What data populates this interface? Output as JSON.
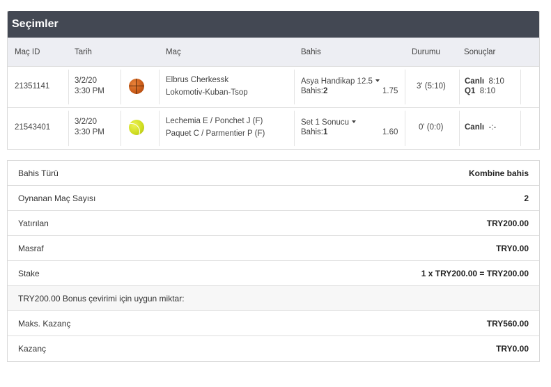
{
  "selections": {
    "title": "Seçimler",
    "headers": {
      "match_id": "Maç ID",
      "date": "Tarih",
      "match": "Maç",
      "bet": "Bahis",
      "status": "Durumu",
      "results": "Sonuçlar"
    },
    "rows": [
      {
        "id": "21351141",
        "date": "3/2/20",
        "time": "3:30 PM",
        "sport_icon": "basketball-icon",
        "team1": "Elbrus Cherkessk",
        "team2": "Lokomotiv-Kuban-Tsop",
        "market": "Asya Handikap 12.5",
        "pick_label": "Bahis:",
        "pick": "2",
        "odds": "1.75",
        "status": "3' (5:10)",
        "res1_label": "Canlı",
        "res1_value": "8:10",
        "res2_label": "Q1",
        "res2_value": "8:10"
      },
      {
        "id": "21543401",
        "date": "3/2/20",
        "time": "3:30 PM",
        "sport_icon": "tennis-ball-icon",
        "team1": "Lechemia E / Ponchet J (F)",
        "team2": "Paquet C / Parmentier P (F)",
        "market": "Set 1 Sonucu",
        "pick_label": "Bahis:",
        "pick": "1",
        "odds": "1.60",
        "status": "0' (0:0)",
        "res1_label": "Canlı",
        "res1_value": "-:-"
      }
    ]
  },
  "summary": {
    "rows": [
      {
        "label": "Bahis Türü",
        "value": "Kombine bahis"
      },
      {
        "label": "Oynanan Maç Sayısı",
        "value": "2"
      },
      {
        "label": "Yatırılan",
        "value": "TRY200.00"
      },
      {
        "label": "Masraf",
        "value": "TRY0.00"
      },
      {
        "label": "Stake",
        "value": "1 x TRY200.00 = TRY200.00"
      },
      {
        "label": "TRY200.00 Bonus çevirimi için uygun miktar:",
        "value": ""
      },
      {
        "label": "Maks. Kazanç",
        "value": "TRY560.00"
      },
      {
        "label": "Kazanç",
        "value": "TRY0.00"
      }
    ]
  }
}
